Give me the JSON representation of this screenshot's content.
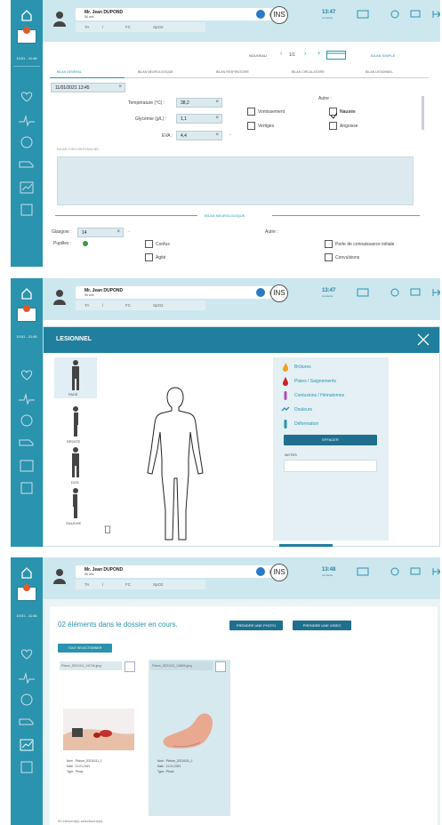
{
  "app": {
    "sidebar_time": "10:51 - 11:46",
    "patient_name": "Mr. Jean DUPOND",
    "patient_age": "56 ans",
    "ins_label": "INS",
    "measure_labels": [
      "TA",
      "/",
      "FC",
      "SpO2"
    ],
    "time_unit": "connecte"
  },
  "panel1": {
    "time": "13:47",
    "mode": "NOUVEAU",
    "pager": "1/1",
    "btn_bilan": "BILAN SIMPLE",
    "tabs": [
      "BILAN GENERAL",
      "BILAN NEUROLOGIQUE",
      "BILAN RESPIRATOIRE",
      "BILAN CIRCULATOIRE",
      "BILAN LESIONNEL"
    ],
    "date_value": "11/01/2021 13:45",
    "temperature_label": "Température (°C) :",
    "temperature_value": "38,2",
    "glycemie_label": "Glycémie (g/L) :",
    "glycemie_value": "1,1",
    "eva_label": "EVA :",
    "eva_value": "4,4",
    "autre1": "Autre :",
    "vomissement": "Vomissement",
    "nausee": "Nausée",
    "vertiges": "Vertiges",
    "angoisse": "Angoisse",
    "circonstance": "BILAN CIRCONSTANCIEL",
    "neuro_title": "BILAN NEUROLOGIQUE",
    "glasgow_label": "Glasgow :",
    "glasgow_value": "14",
    "autre2": "Autre :",
    "pupilles": "Pupilles :",
    "confus": "Confus",
    "agite": "Agité",
    "perte": "Perte de connaissance initiale",
    "convulsions": "Convulsions"
  },
  "panel2": {
    "time": "13:47",
    "title": "LESIONNEL",
    "views": [
      "FACE",
      "DROITE",
      "DOS",
      "GAUCHE"
    ],
    "legend": [
      "Brûlures",
      "Plaies / Saignements",
      "Contusions / Hématomes",
      "Douleurs",
      "Déformation"
    ],
    "legend_colors": [
      "#f0a020",
      "#d32020",
      "#b04ab0",
      "#2a93ad",
      "#2a93ad"
    ],
    "btn_effacer": "EFFACER",
    "notes_label": "NOTES"
  },
  "panel3": {
    "time": "13:48",
    "count_title": "02 éléments dans le dossier en cours.",
    "btn_photo": "PRENDRE UNE PHOTO",
    "btn_video": "PRENDRE UNE VIDEO",
    "btn_select": "TOUT SELECTIONNER",
    "items": [
      {
        "filename": "Picture_20210111_141746.jpeg",
        "meta": [
          "Nom : Picture_20210111_1",
          "Date : 11-01-2021",
          "Type : Photo"
        ]
      },
      {
        "filename": "Picture_20210111_134806.jpeg",
        "meta": [
          "Nom : Picture_20210111_1",
          "Date : 11-01-2021",
          "Type : Photo"
        ]
      }
    ],
    "selected": "00 élément(s) sélectionné(s)"
  }
}
